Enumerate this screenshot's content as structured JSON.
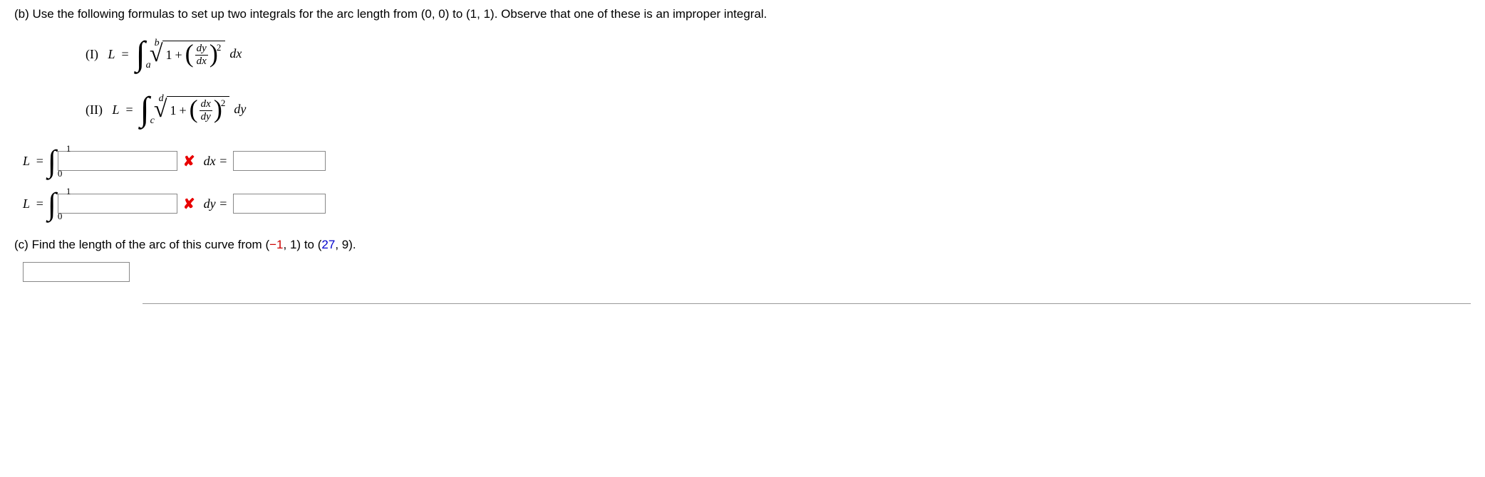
{
  "partB": {
    "label": "(b)",
    "text": "Use the following formulas to set up two integrals for the arc length from (0, 0) to (1, 1). Observe that one of these is an improper integral."
  },
  "formulaI": {
    "label": "(I)",
    "var": "L",
    "eq": "=",
    "upper": "b",
    "lower": "a",
    "one": "1",
    "plus": "+",
    "num": "dy",
    "den": "dx",
    "exp": "2",
    "dvar": "dx"
  },
  "formulaII": {
    "label": "(II)",
    "var": "L",
    "eq": "=",
    "upper": "d",
    "lower": "c",
    "one": "1",
    "plus": "+",
    "num": "dx",
    "den": "dy",
    "exp": "2",
    "dvar": "dy"
  },
  "answer1": {
    "L": "L",
    "eq": "=",
    "upper": "1",
    "lower": "0",
    "wrong": "✘",
    "post": "dx  ="
  },
  "answer2": {
    "L": "L",
    "eq": "=",
    "upper": "1",
    "lower": "0",
    "wrong": "✘",
    "post": "dy  ="
  },
  "partC": {
    "label": "(c)",
    "pre": "Find the length of the arc of this curve from ",
    "p1a": "(",
    "p1n": "−1",
    "p1c": ", 1)",
    "mid": " to ",
    "p2a": "(",
    "p2n": "27",
    "p2c": ", 9)",
    "post": "."
  }
}
